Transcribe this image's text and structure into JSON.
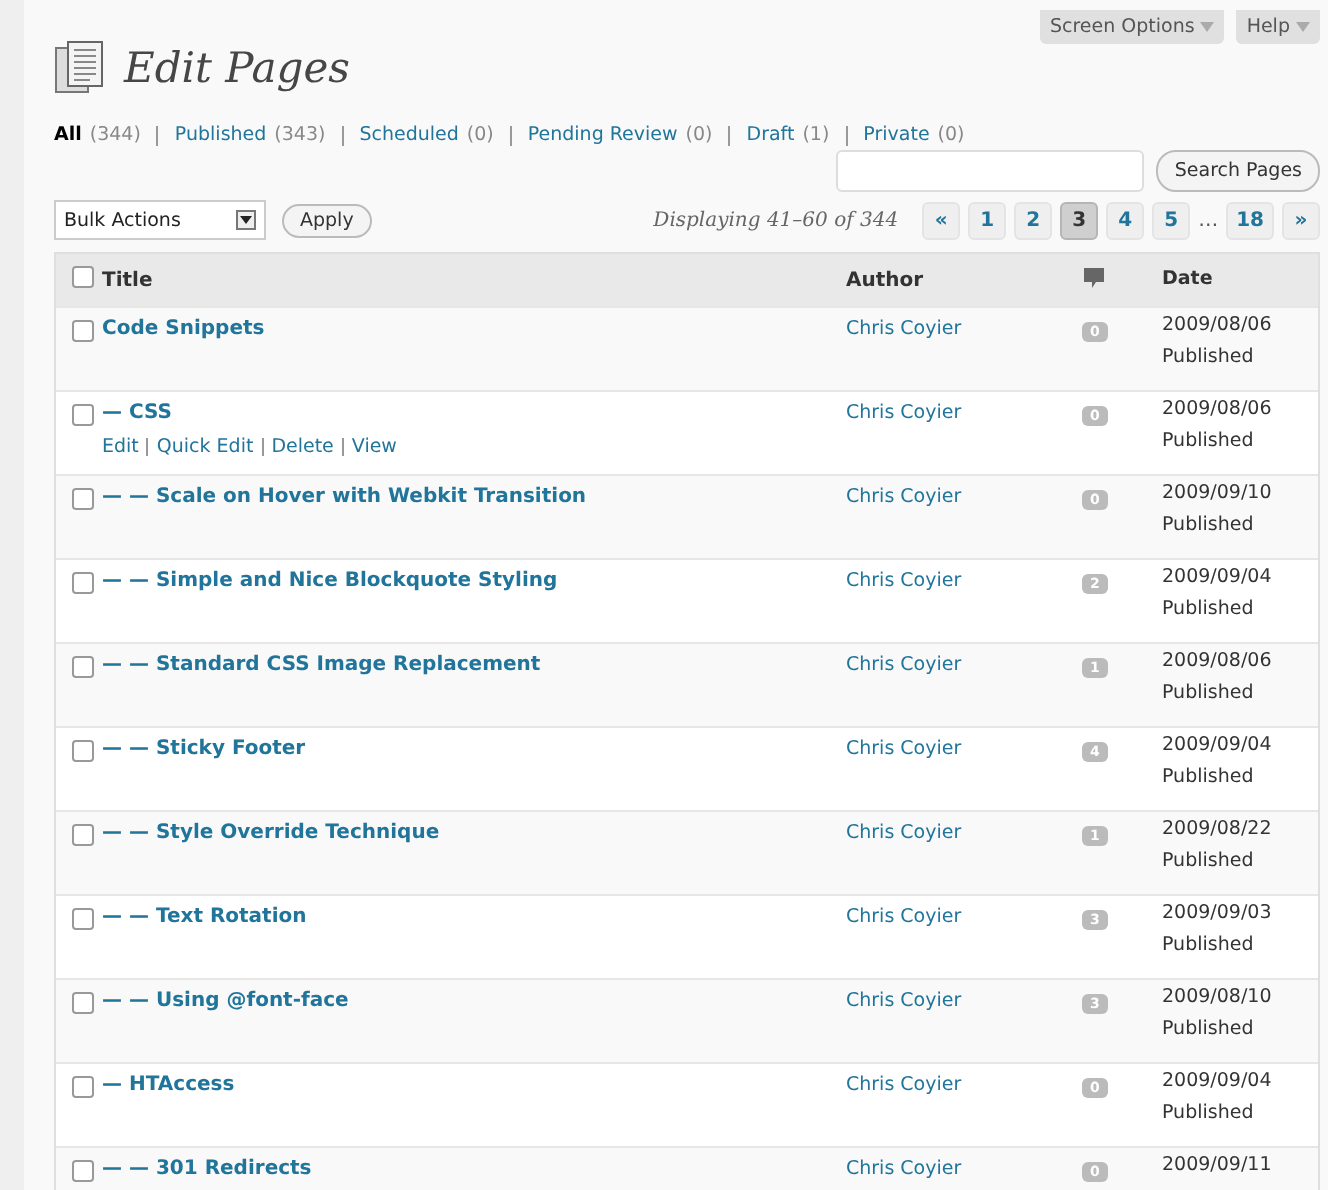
{
  "top_buttons": [
    "Screen Options",
    "Help"
  ],
  "title": "Edit Pages",
  "filters": [
    {
      "label": "All",
      "count": "(344)",
      "selected": true
    },
    {
      "label": "Published",
      "count": "(343)",
      "selected": false
    },
    {
      "label": "Scheduled",
      "count": "(0)",
      "selected": false
    },
    {
      "label": "Pending Review",
      "count": "(0)",
      "selected": false
    },
    {
      "label": "Draft",
      "count": "(1)",
      "selected": false
    },
    {
      "label": "Private",
      "count": "(0)",
      "selected": false
    }
  ],
  "search_button": "Search Pages",
  "bulk_actions": "Bulk Actions",
  "apply_button": "Apply",
  "displaying": "Displaying 41–60 of 344",
  "pagination": [
    {
      "label": "«",
      "selected": false
    },
    {
      "label": "1",
      "selected": false
    },
    {
      "label": "2",
      "selected": false
    },
    {
      "label": "3",
      "selected": true
    },
    {
      "label": "4",
      "selected": false
    },
    {
      "label": "5",
      "selected": false
    },
    {
      "label": "…",
      "kind": "gap"
    },
    {
      "label": "18",
      "selected": false
    },
    {
      "label": "»",
      "selected": false
    }
  ],
  "columns": [
    "Title",
    "Author",
    "Date"
  ],
  "select_all_checked": false,
  "rows": [
    {
      "title": "Code Snippets",
      "author": "Chris Coyier",
      "comments": "0",
      "date": "2009/08/06",
      "status": "Published",
      "checked": false
    },
    {
      "title": "— CSS",
      "author": "Chris Coyier",
      "comments": "0",
      "date": "2009/08/06",
      "status": "Published",
      "actions": [
        "Edit",
        "Quick Edit",
        "Delete",
        "View"
      ],
      "checked": false
    },
    {
      "title": "— — Scale on Hover with Webkit Transition",
      "author": "Chris Coyier",
      "comments": "0",
      "date": "2009/09/10",
      "status": "Published",
      "checked": false
    },
    {
      "title": "— — Simple and Nice Blockquote Styling",
      "author": "Chris Coyier",
      "comments": "2",
      "date": "2009/09/04",
      "status": "Published",
      "checked": false
    },
    {
      "title": "— — Standard CSS Image Replacement",
      "author": "Chris Coyier",
      "comments": "1",
      "date": "2009/08/06",
      "status": "Published",
      "checked": false
    },
    {
      "title": "— — Sticky Footer",
      "author": "Chris Coyier",
      "comments": "4",
      "date": "2009/09/04",
      "status": "Published",
      "checked": false
    },
    {
      "title": "— — Style Override Technique",
      "author": "Chris Coyier",
      "comments": "1",
      "date": "2009/08/22",
      "status": "Published",
      "checked": false
    },
    {
      "title": "— — Text Rotation",
      "author": "Chris Coyier",
      "comments": "3",
      "date": "2009/09/03",
      "status": "Published",
      "checked": false
    },
    {
      "title": "— — Using @font-face",
      "author": "Chris Coyier",
      "comments": "3",
      "date": "2009/08/10",
      "status": "Published",
      "checked": false
    },
    {
      "title": "— HTAccess",
      "author": "Chris Coyier",
      "comments": "0",
      "date": "2009/09/04",
      "status": "Published",
      "checked": false
    },
    {
      "title": "— — 301 Redirects",
      "author": "Chris Coyier",
      "comments": "0",
      "date": "2009/09/11",
      "checked": false
    }
  ]
}
